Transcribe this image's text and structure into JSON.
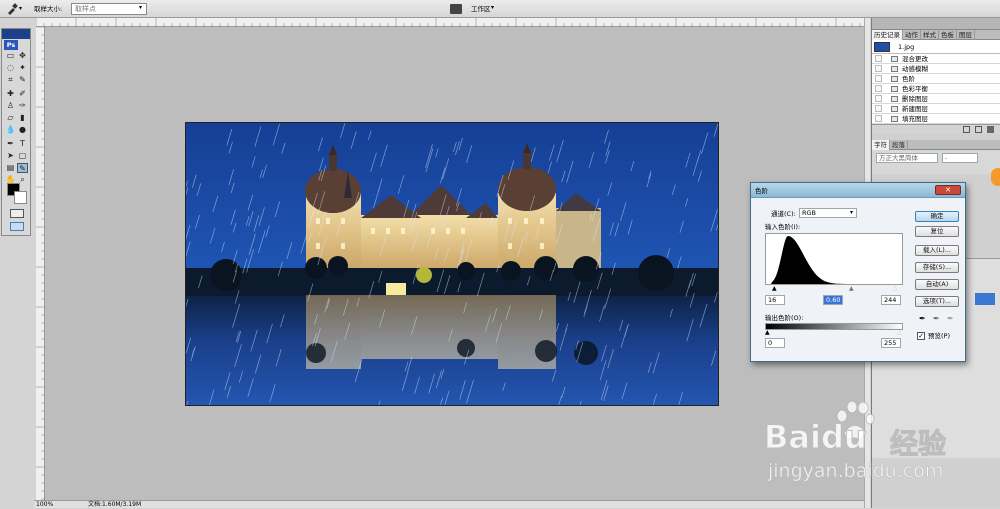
{
  "options_bar": {
    "sample_size_label": "取样大小:",
    "sample_size_value": "取样点",
    "workspace_label": "工作区"
  },
  "status": {
    "zoom": "100%",
    "doc_info": "文档:1.60M/3.19M"
  },
  "history_panel": {
    "tabs": [
      "历史记录",
      "动作",
      "样式",
      "色板",
      "图层"
    ],
    "snapshot": "1.jpg",
    "items": [
      "混合更改",
      "动感模糊",
      "色阶",
      "色彩平衡",
      "删除图层",
      "新建图层",
      "填充图层"
    ]
  },
  "char_panel": {
    "tabs": [
      "字符",
      "段落"
    ],
    "font_name": "方正大黑简体",
    "font_style": "-"
  },
  "levels_dialog": {
    "title": "色阶",
    "channel_label": "通道(C):",
    "channel_value": "RGB",
    "input_levels_label": "输入色阶(I):",
    "input_black": "16",
    "input_gamma": "0.60",
    "input_white": "244",
    "output_levels_label": "输出色阶(O):",
    "output_black": "0",
    "output_white": "255",
    "buttons": {
      "ok": "确定",
      "reset": "复位",
      "load": "载入(L)...",
      "save": "存储(S)...",
      "auto": "自动(A)",
      "options": "选项(T)..."
    },
    "preview_label": "预览(P)",
    "preview_checked": true
  },
  "toolbox": {
    "header": "Ps"
  },
  "watermark": {
    "brand": "Baidu",
    "brand_suffix": "经验",
    "url": "jingyan.baidu.com"
  },
  "colors": {
    "title_bar": "#8ab8d6",
    "panel_bg": "#d0d0d0",
    "workspace": "#bdbdbd",
    "sky": "#1c4fa8"
  }
}
